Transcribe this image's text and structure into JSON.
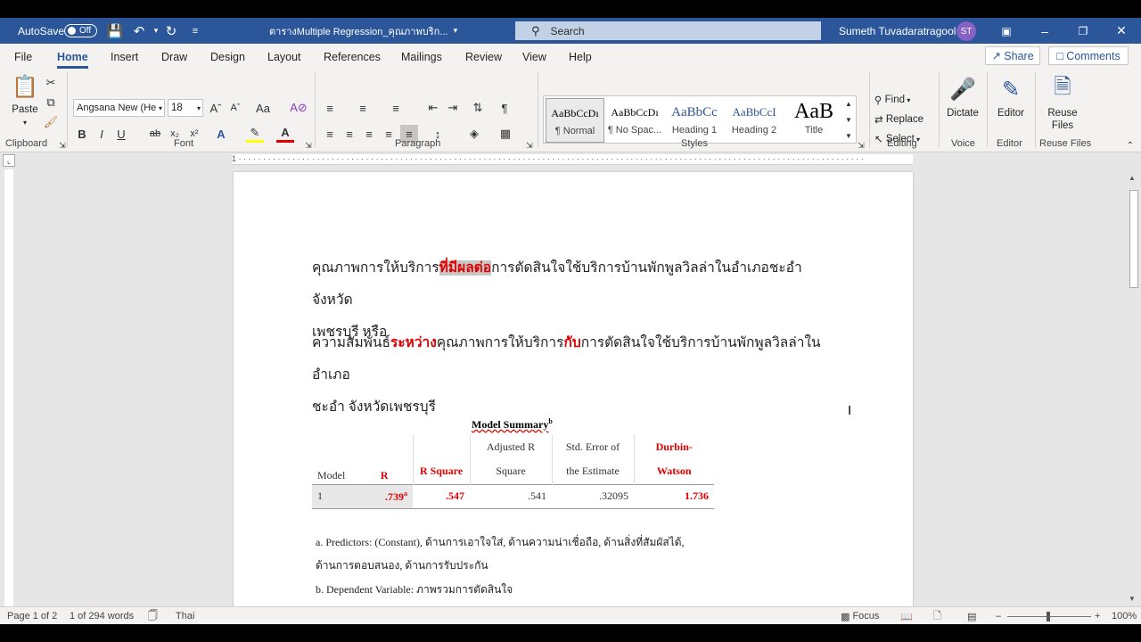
{
  "titlebar": {
    "autosave_label": "AutoSave",
    "autosave_state": "Off",
    "doc_title": "ตารางMultiple Regression_คุณภาพบริก...",
    "search_placeholder": "Search",
    "user_name": "Sumeth Tuvadaratragool",
    "user_initials": "ST"
  },
  "tabs": [
    {
      "label": "File"
    },
    {
      "label": "Home"
    },
    {
      "label": "Insert"
    },
    {
      "label": "Draw"
    },
    {
      "label": "Design"
    },
    {
      "label": "Layout"
    },
    {
      "label": "References"
    },
    {
      "label": "Mailings"
    },
    {
      "label": "Review"
    },
    {
      "label": "View"
    },
    {
      "label": "Help"
    }
  ],
  "share_label": "Share",
  "comments_label": "Comments",
  "ribbon": {
    "paste_label": "Paste",
    "font_name": "Angsana New (He",
    "font_size": "18",
    "styles": [
      {
        "preview": "AaBbCcDı",
        "name": "¶ Normal"
      },
      {
        "preview": "AaBbCcDı",
        "name": "¶ No Spac..."
      },
      {
        "preview": "AaBbCc",
        "name": "Heading 1"
      },
      {
        "preview": "AaBbCcI",
        "name": "Heading 2"
      },
      {
        "preview": "AaB",
        "name": "Title"
      }
    ],
    "find_label": "Find",
    "replace_label": "Replace",
    "select_label": "Select",
    "dictate_label": "Dictate",
    "editor_label": "Editor",
    "reuse_label": "Reuse Files",
    "groups": {
      "clipboard": "Clipboard",
      "font": "Font",
      "paragraph": "Paragraph",
      "styles": "Styles",
      "editing": "Editing",
      "voice": "Voice",
      "editor": "Editor",
      "reuse": "Reuse Files"
    }
  },
  "doc": {
    "p1_a": "คุณภาพการให้บริการ",
    "p1_red": "ที่มีผลต่อ",
    "p1_b": "การตัดสินใจใช้บริการบ้านพักพูลวิลล่าในอำเภอชะอำ จังหวัด",
    "p1_c": "เพชรบุรี หรือ",
    "p2_a": "ความสัมพันธ์",
    "p2_red1": "ระหว่าง",
    "p2_b": "คุณภาพการให้บริการ",
    "p2_red2": "กับ",
    "p2_c": "การตัดสินใจใช้บริการบ้านพักพูลวิลล่าในอำเภอ",
    "p2_d": "ชะอำ จังหวัดเพชรบุรี",
    "table_title": "Model Summary",
    "table_title_sup": "b",
    "headers": {
      "model": "Model",
      "r": "R",
      "r_square": "R Square",
      "adj_r_1": "Adjusted R",
      "adj_r_2": "Square",
      "std_err_1": "Std. Error of",
      "std_err_2": "the Estimate",
      "dw_1": "Durbin-",
      "dw_2": "Watson"
    },
    "row": {
      "model": "1",
      "r": ".739",
      "r_sup": "a",
      "r_square": ".547",
      "adj_r": ".541",
      "std_err": ".32095",
      "dw": "1.736"
    },
    "note_a1": "a. Predictors: (Constant), ด้านการเอาใจใส่, ด้านความน่าเชื่อถือ, ด้านสิ่งที่สัมผัสได้,",
    "note_a2": "ด้านการตอบสนอง, ด้านการรับประกัน",
    "note_b": "b. Dependent Variable: ภาพรวมการตัดสินใจ"
  },
  "status": {
    "page": "Page 1 of 2",
    "words": "1 of 294 words",
    "language": "Thai",
    "focus": "Focus",
    "zoom": "100%"
  }
}
